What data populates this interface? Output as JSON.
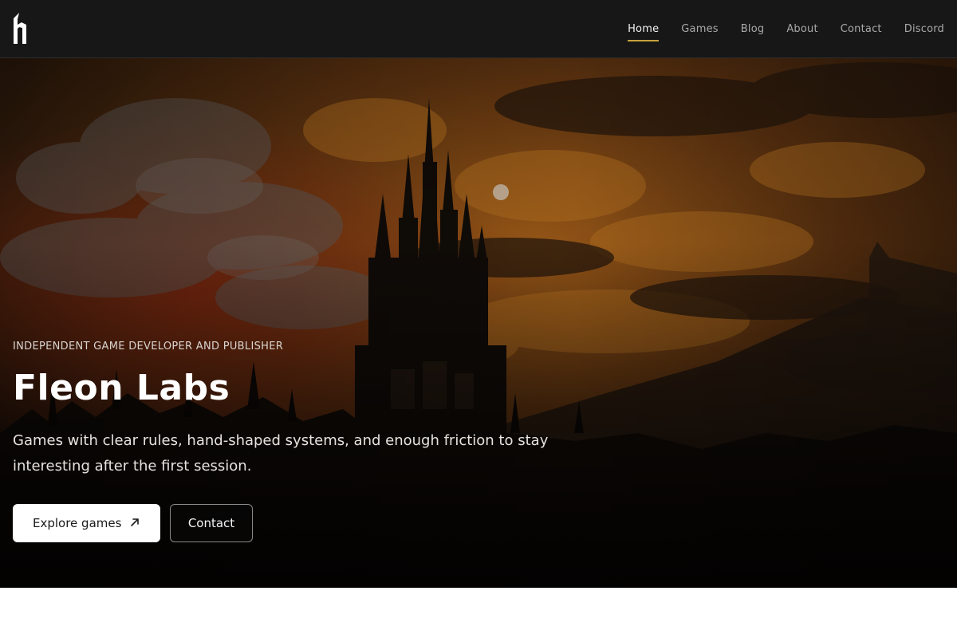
{
  "brand": {
    "logo_icon": "fleon-logo-icon",
    "accent_color": "#c8a23c"
  },
  "nav": {
    "items": [
      {
        "label": "Home",
        "active": true
      },
      {
        "label": "Games",
        "active": false
      },
      {
        "label": "Blog",
        "active": false
      },
      {
        "label": "About",
        "active": false
      },
      {
        "label": "Contact",
        "active": false
      },
      {
        "label": "Discord",
        "active": false
      }
    ]
  },
  "hero": {
    "eyebrow": "INDEPENDENT GAME DEVELOPER AND PUBLISHER",
    "title": "Fleon Labs",
    "description": "Games with clear rules, hand-shaped systems, and enough friction to stay interesting after the first session.",
    "primary_button": {
      "label": "Explore games",
      "icon": "arrow-up-right-icon"
    },
    "secondary_button": {
      "label": "Contact"
    }
  }
}
